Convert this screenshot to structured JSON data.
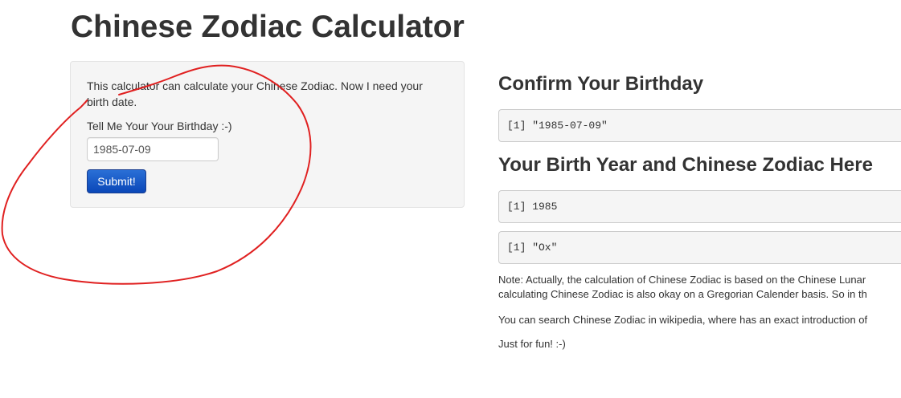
{
  "page": {
    "title": "Chinese Zodiac Calculator"
  },
  "sidebar": {
    "intro_line1": "This calculator can calculate your Chinese Zodiac. Now I need your",
    "intro_line2": "birth date.",
    "input_label": "Tell Me Your Your Birthday :-)",
    "date_value": "1985-07-09",
    "submit_label": "Submit!"
  },
  "main": {
    "confirm_heading": "Confirm Your Birthday",
    "confirm_output": "[1] \"1985-07-09\"",
    "result_heading": "Your Birth Year and Chinese Zodiac Here",
    "year_output": "[1] 1985",
    "zodiac_output": "[1] \"Ox\"",
    "note_line1": "Note: Actually, the calculation of Chinese Zodiac is based on the Chinese Lunar",
    "note_line2": "calculating Chinese Zodiac is also okay on a Gregorian Calender basis. So in th",
    "wiki_text": "You can search Chinese Zodiac in wikipedia, where has an exact introduction of",
    "fun_text": "Just for fun! :-)"
  },
  "colors": {
    "annotation_stroke": "#e02020",
    "button_background": "#0a47b8",
    "panel_background": "#f5f5f5"
  }
}
